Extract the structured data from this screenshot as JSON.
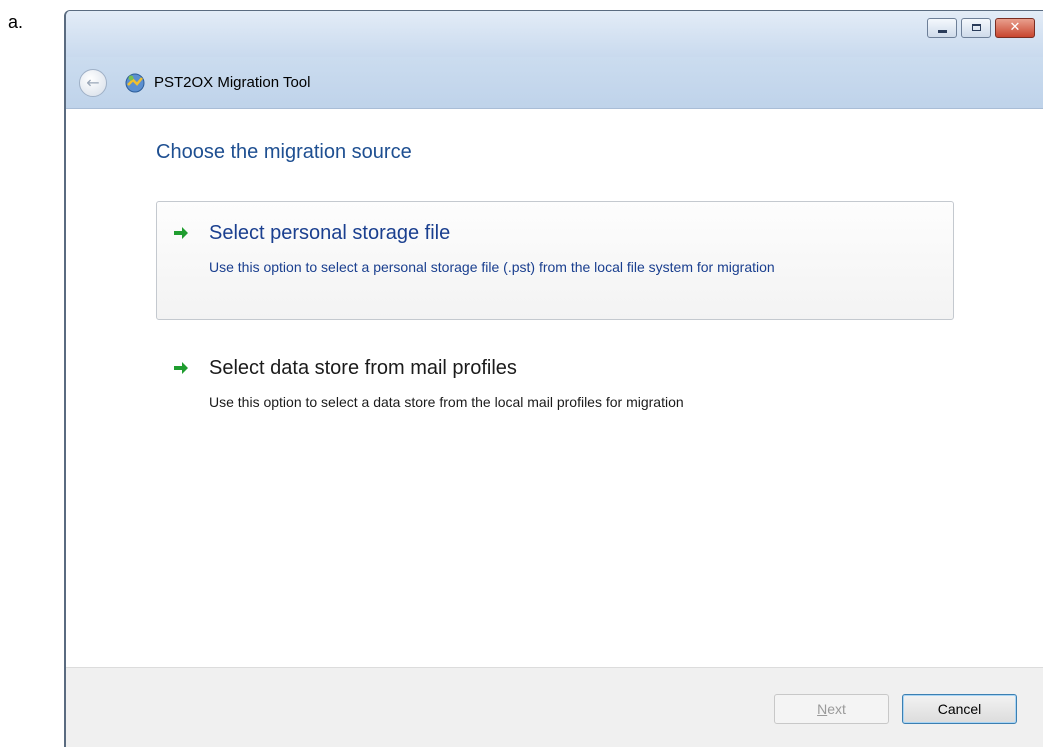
{
  "doc_label": "a.",
  "window": {
    "title": "PST2OX Migration Tool",
    "controls": {
      "minimize": "minimize",
      "maximize": "maximize",
      "close": "✕"
    }
  },
  "wizard": {
    "heading": "Choose the migration source",
    "options": [
      {
        "title": "Select personal storage file",
        "description": "Use this option to select a personal storage file (.pst) from the local file system for migration",
        "icon": "green-arrow-icon"
      },
      {
        "title": "Select data store from mail profiles",
        "description": "Use this option to select a data store from the local mail profiles for migration",
        "icon": "green-arrow-icon"
      }
    ]
  },
  "footer": {
    "next_prefix": "",
    "next_underlined": "N",
    "next_rest": "ext",
    "cancel_label": "Cancel"
  },
  "colors": {
    "heading": "#1e4f91",
    "link": "#1a3f8f",
    "titlebar": "#c9daee",
    "arrow": "#1f9d2f"
  }
}
